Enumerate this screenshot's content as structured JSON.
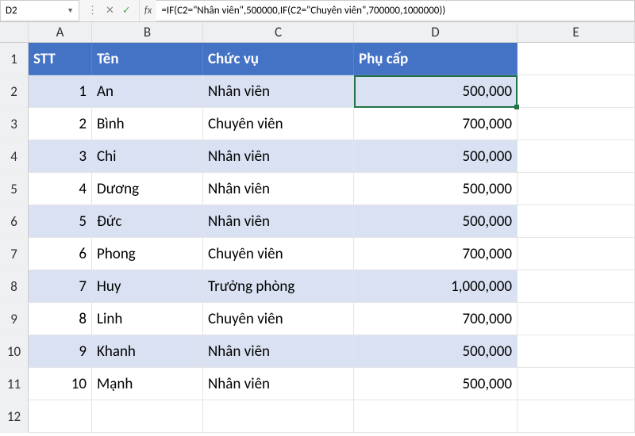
{
  "namebox": "D2",
  "fx_label": "fx",
  "toolbar_icons": {
    "ellipsis": "⋮",
    "cancel": "✕",
    "accept": "✓"
  },
  "formula": "=IF(C2=\"Nhân viên\",500000,IF(C2=\"Chuyên viên\",700000,1000000))",
  "columns": [
    "A",
    "B",
    "C",
    "D",
    "E"
  ],
  "headers": {
    "stt": "STT",
    "ten": "Tên",
    "chucvu": "Chức vụ",
    "phucap": "Phụ cấp"
  },
  "selected_cell": "D2",
  "rows": [
    {
      "n": 1,
      "stt": "1",
      "ten": "An",
      "cv": "Nhân viên",
      "pc": "500,000"
    },
    {
      "n": 2,
      "stt": "2",
      "ten": "Bình",
      "cv": "Chuyên viên",
      "pc": "700,000"
    },
    {
      "n": 3,
      "stt": "3",
      "ten": "Chi",
      "cv": "Nhân viên",
      "pc": "500,000"
    },
    {
      "n": 4,
      "stt": "4",
      "ten": "Dương",
      "cv": "Nhân viên",
      "pc": "500,000"
    },
    {
      "n": 5,
      "stt": "5",
      "ten": "Đức",
      "cv": "Nhân viên",
      "pc": "500,000"
    },
    {
      "n": 6,
      "stt": "6",
      "ten": "Phong",
      "cv": "Chuyên viên",
      "pc": "700,000"
    },
    {
      "n": 7,
      "stt": "7",
      "ten": "Huy",
      "cv": "Trưởng phòng",
      "pc": "1,000,000"
    },
    {
      "n": 8,
      "stt": "8",
      "ten": "Linh",
      "cv": "Chuyên viên",
      "pc": "700,000"
    },
    {
      "n": 9,
      "stt": "9",
      "ten": "Khanh",
      "cv": "Nhân viên",
      "pc": "500,000"
    },
    {
      "n": 10,
      "stt": "10",
      "ten": "Mạnh",
      "cv": "Nhân viên",
      "pc": "500,000"
    }
  ],
  "extra_rows": [
    12
  ]
}
